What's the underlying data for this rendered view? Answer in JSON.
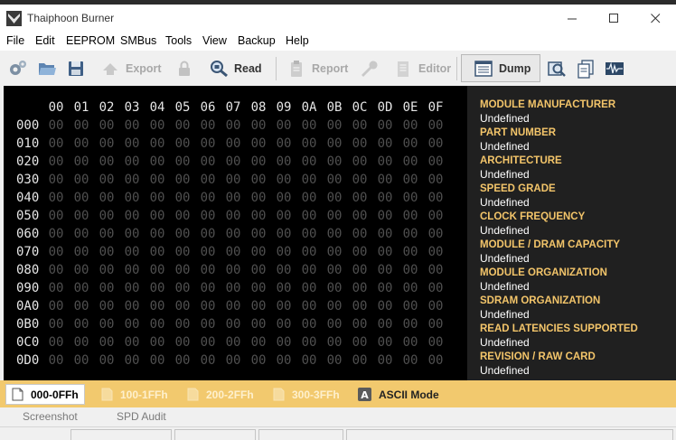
{
  "window": {
    "title": "Thaiphoon Burner"
  },
  "menu": [
    "File",
    "Edit",
    "EEPROM",
    "SMBus",
    "Tools",
    "View",
    "Backup",
    "Help"
  ],
  "toolbar": {
    "export_label": "Export",
    "read_label": "Read",
    "report_label": "Report",
    "editor_label": "Editor",
    "dump_label": "Dump"
  },
  "hex": {
    "columns": [
      "00",
      "01",
      "02",
      "03",
      "04",
      "05",
      "06",
      "07",
      "08",
      "09",
      "0A",
      "0B",
      "0C",
      "0D",
      "0E",
      "0F"
    ],
    "rows": [
      "000",
      "010",
      "020",
      "030",
      "040",
      "050",
      "060",
      "070",
      "080",
      "090",
      "0A0",
      "0B0",
      "0C0",
      "0D0"
    ],
    "cell_value": "00"
  },
  "info": [
    {
      "label": "MODULE MANUFACTURER",
      "value": "Undefined"
    },
    {
      "label": "PART NUMBER",
      "value": "Undefined"
    },
    {
      "label": "ARCHITECTURE",
      "value": "Undefined"
    },
    {
      "label": "SPEED GRADE",
      "value": "Undefined"
    },
    {
      "label": "CLOCK FREQUENCY",
      "value": "Undefined"
    },
    {
      "label": "MODULE / DRAM CAPACITY",
      "value": "Undefined"
    },
    {
      "label": "MODULE ORGANIZATION",
      "value": "Undefined"
    },
    {
      "label": "SDRAM ORGANIZATION",
      "value": "Undefined"
    },
    {
      "label": "READ LATENCIES SUPPORTED",
      "value": "Undefined"
    },
    {
      "label": "REVISION / RAW CARD",
      "value": "Undefined"
    }
  ],
  "page_tabs": {
    "t0": "000-0FFh",
    "t1": "100-1FFh",
    "t2": "200-2FFh",
    "t3": "300-3FFh",
    "ascii": "ASCII Mode"
  },
  "bottom_tabs": {
    "screenshot": "Screenshot",
    "spd_audit": "SPD Audit"
  },
  "colors": {
    "hex_background": "#000000",
    "info_label": "#f3c56a",
    "tabbar": "#f2c96e"
  }
}
